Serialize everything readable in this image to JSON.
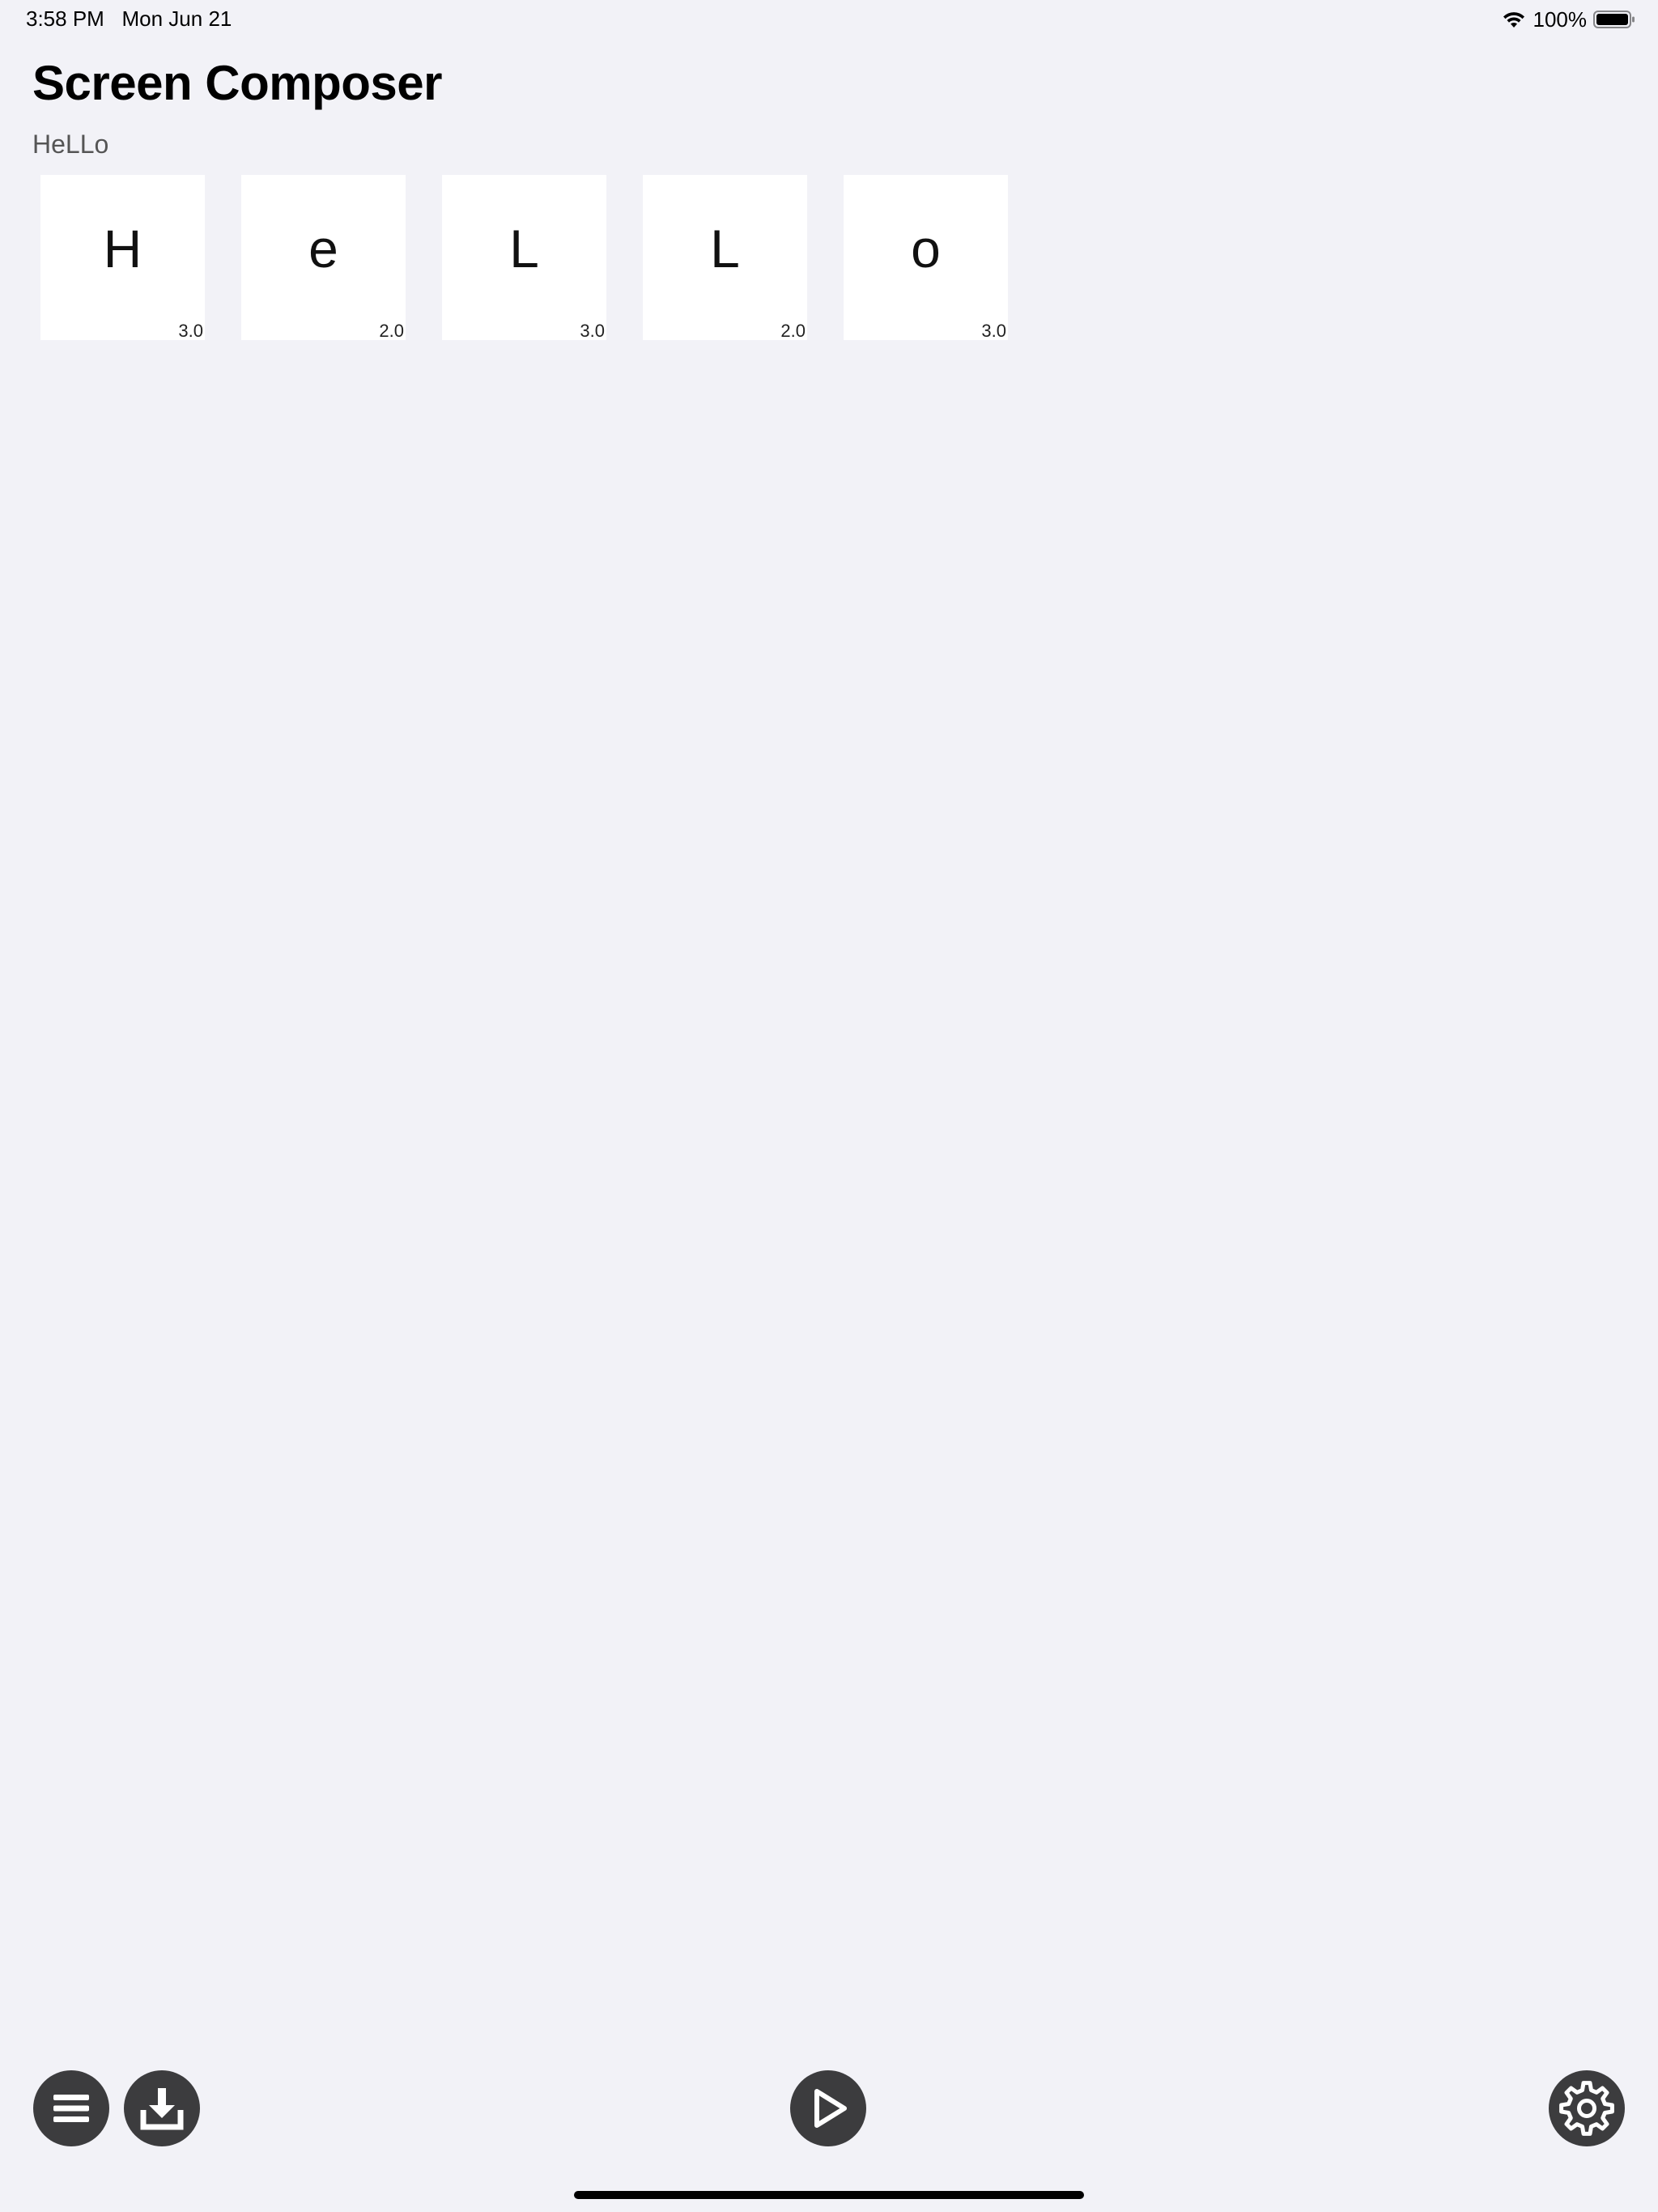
{
  "status_bar": {
    "time": "3:58 PM",
    "date": "Mon Jun 21",
    "battery_percent": "100%",
    "battery_level": 1.0
  },
  "header": {
    "title": "Screen Composer",
    "composed_text": "HeLLo"
  },
  "tiles": [
    {
      "letter": "H",
      "value": "3.0"
    },
    {
      "letter": "e",
      "value": "2.0"
    },
    {
      "letter": "L",
      "value": "3.0"
    },
    {
      "letter": "L",
      "value": "2.0"
    },
    {
      "letter": "o",
      "value": "3.0"
    }
  ],
  "toolbar": {
    "menu_icon": "list-icon",
    "download_icon": "download-icon",
    "play_icon": "play-icon",
    "settings_icon": "gear-icon"
  },
  "colors": {
    "background": "#f2f2f7",
    "tile_background": "#ffffff",
    "button_fill": "#3c3c3e"
  }
}
